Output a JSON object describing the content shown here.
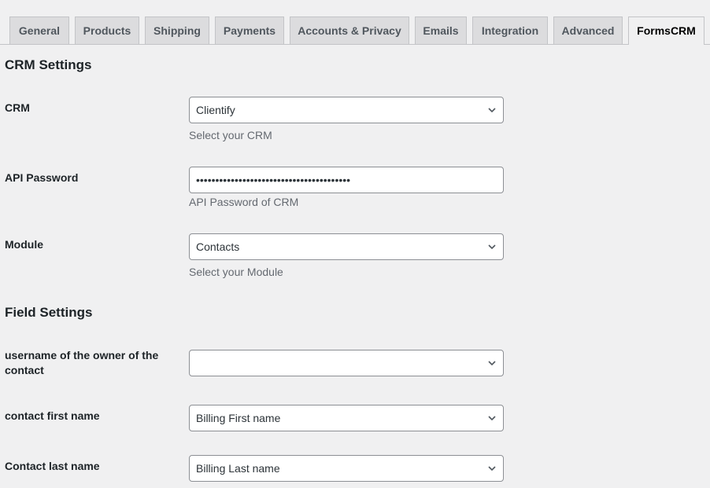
{
  "tabs": [
    {
      "label": "General"
    },
    {
      "label": "Products"
    },
    {
      "label": "Shipping"
    },
    {
      "label": "Payments"
    },
    {
      "label": "Accounts & Privacy"
    },
    {
      "label": "Emails"
    },
    {
      "label": "Integration"
    },
    {
      "label": "Advanced"
    },
    {
      "label": "FormsCRM",
      "active": true
    }
  ],
  "crm_settings": {
    "title": "CRM Settings",
    "crm": {
      "label": "CRM",
      "value": "Clientify",
      "description": "Select your CRM"
    },
    "api_password": {
      "label": "API Password",
      "value": "••••••••••••••••••••••••••••••••••••••••",
      "description": "API Password of CRM"
    },
    "module": {
      "label": "Module",
      "value": "Contacts",
      "description": "Select your Module"
    }
  },
  "field_settings": {
    "title": "Field Settings",
    "fields": [
      {
        "label": "username of the owner of the contact",
        "value": ""
      },
      {
        "label": "contact first name",
        "value": "Billing First name"
      },
      {
        "label": "Contact last name",
        "value": "Billing Last name"
      }
    ]
  },
  "icons": {
    "dropdown": "chevron-down-icon"
  }
}
